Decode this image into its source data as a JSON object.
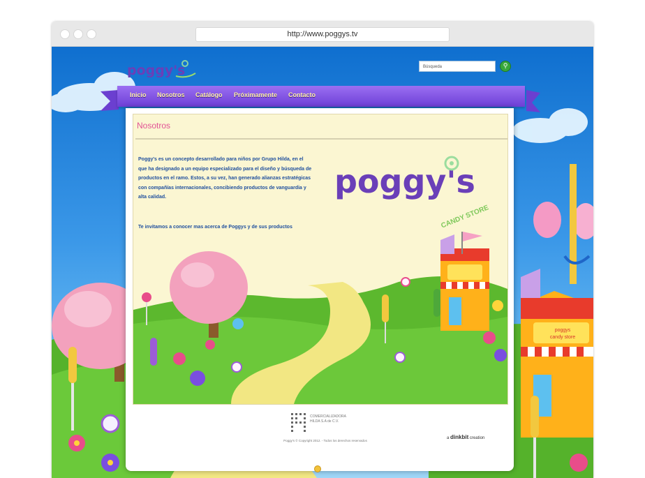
{
  "browser": {
    "url": "http://www.poggys.tv"
  },
  "site": {
    "brand_logo_text": "poggy's",
    "search_placeholder": "Búsqueda"
  },
  "nav": {
    "items": [
      {
        "label": "Inicio"
      },
      {
        "label": "Nosotros"
      },
      {
        "label": "Catálogo"
      },
      {
        "label": "Próximamente"
      },
      {
        "label": "Contacto"
      }
    ]
  },
  "page": {
    "title": "Nosotros",
    "intro": "Poggy's es un concepto desarrollado para niños por Grupo Hilda, en el que ha designado a un equipo especializado para el diseño y búsqueda de productos en el ramo. Estos, a su vez, han generado alianzas estratégicas con compañías internacionales, concibiendo productos de vanguardia y alta calidad.",
    "invite": "Te invitamos a conocer mas acerca de Poggys y de sus productos",
    "store_logo_text": "poggy's",
    "store_logo_tagline": "CANDY STORE",
    "store_sign_1": "poggys",
    "store_sign_2": "candy store"
  },
  "footer": {
    "company_line1": "COMERCIALIZADORA",
    "company_line2": "HILDA S.A de C.V.",
    "copyright": "Poggy's © Copyright 2012. - Todos los derechos reservados",
    "credit_prefix": "a",
    "credit_brand": "dinkbit",
    "credit_suffix": "creation"
  },
  "colors": {
    "sky_top": "#0f6fcf",
    "nav_purple": "#7a4ee0",
    "nav_text": "#fff3a6",
    "heading_pink": "#e25395",
    "body_blue": "#1f4f9e",
    "content_bg": "#fbf6d2",
    "grass": "#5cb82e",
    "path_yellow": "#f2e783"
  }
}
